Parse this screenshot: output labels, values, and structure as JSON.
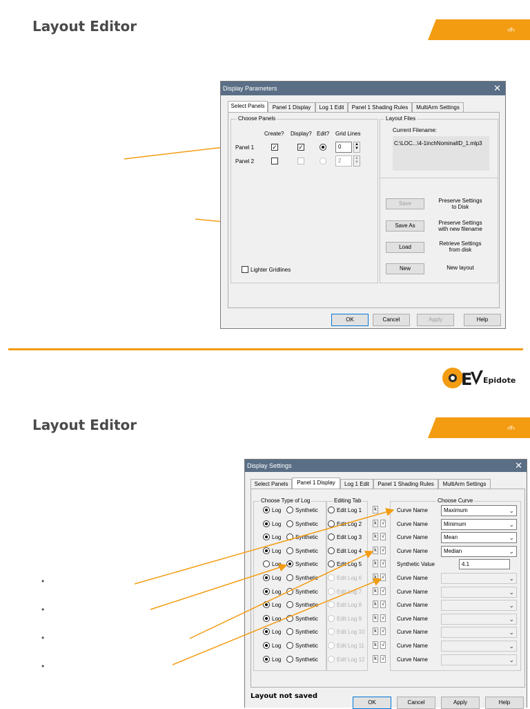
{
  "slide1": {
    "title": "Layout Editor",
    "page_num": "‹#›",
    "dialog": {
      "title": "Display Parameters",
      "close": "✕",
      "tabs": [
        "Select Panels",
        "Panel 1 Display",
        "Log 1 Edit",
        "Panel 1 Shading Rules",
        "MultiArm Settings"
      ],
      "choose_panels": {
        "label": "Choose Panels",
        "headers": {
          "create": "Create?",
          "display": "Display?",
          "edit": "Edit?",
          "grid": "Grid Lines"
        },
        "rows": [
          {
            "name": "Panel 1",
            "create": true,
            "display": true,
            "edit": true,
            "grid": "0"
          },
          {
            "name": "Panel 2",
            "create": false,
            "display": false,
            "edit": false,
            "grid": "2"
          }
        ],
        "lighter_gridlines": "Lighter Gridlines"
      },
      "layout_files": {
        "label": "Layout Files",
        "current_label": "Current Filename:",
        "filename": "C:\\LOC...\\4-1inchNominalID_1.mlp3",
        "actions": [
          {
            "button": "Save",
            "desc1": "Preserve Settings",
            "desc2": "to Disk"
          },
          {
            "button": "Save As",
            "desc1": "Preserve Settings",
            "desc2": "with new filename"
          },
          {
            "button": "Load",
            "desc1": "Retrieve Settings",
            "desc2": "from disk"
          },
          {
            "button": "New",
            "desc1": "New layout",
            "desc2": ""
          }
        ]
      },
      "footer": {
        "ok": "OK",
        "cancel": "Cancel",
        "apply": "Apply",
        "help": "Help"
      }
    }
  },
  "logo_text": "Epidote",
  "slide2": {
    "title": "Layout Editor",
    "page_num": "‹#›",
    "bullets": [
      "•",
      "•",
      "•",
      "•"
    ],
    "dialog": {
      "title": "Display Settings",
      "close": "✕",
      "tabs": [
        "Select Panels",
        "Panel 1 Display",
        "Log 1 Edit",
        "Panel 1 Shading Rules",
        "MultiArm Settings"
      ],
      "choose_type_label": "Choose Type of Log",
      "editing_tab_label": "Editing Tab",
      "choose_curve_label": "Choose Curve",
      "log_label": "Log",
      "synthetic_label": "Synthetic",
      "k_label": "k",
      "v_label": "√",
      "rows": [
        {
          "type": "Log",
          "edit": "Edit Log 1",
          "curve_label": "Curve Name",
          "value": "Maximum",
          "enabled": true
        },
        {
          "type": "Log",
          "edit": "Edit Log 2",
          "curve_label": "Curve Name",
          "value": "Minimum",
          "enabled": true
        },
        {
          "type": "Log",
          "edit": "Edit Log 3",
          "curve_label": "Curve Name",
          "value": "Mean",
          "enabled": true
        },
        {
          "type": "Log",
          "edit": "Edit Log 4",
          "curve_label": "Curve Name",
          "value": "Median",
          "enabled": true
        },
        {
          "type": "Synthetic",
          "edit": "Edit Log 5",
          "curve_label": "Synthetic Value",
          "value": "4.1",
          "enabled": true
        },
        {
          "type": "Log",
          "edit": "Edit Log 6",
          "curve_label": "Curve Name",
          "value": "",
          "enabled": false
        },
        {
          "type": "Log",
          "edit": "Edit Log 7",
          "curve_label": "Curve Name",
          "value": "",
          "enabled": false
        },
        {
          "type": "Log",
          "edit": "Edit Log 8",
          "curve_label": "Curve Name",
          "value": "",
          "enabled": false
        },
        {
          "type": "Log",
          "edit": "Edit Log 9",
          "curve_label": "Curve Name",
          "value": "",
          "enabled": false
        },
        {
          "type": "Log",
          "edit": "Edit Log 10",
          "curve_label": "Curve Name",
          "value": "",
          "enabled": false
        },
        {
          "type": "Log",
          "edit": "Edit Log 11",
          "curve_label": "Curve Name",
          "value": "",
          "enabled": false
        },
        {
          "type": "Log",
          "edit": "Edit Log 12",
          "curve_label": "Curve Name",
          "value": "",
          "enabled": false
        }
      ],
      "status": "Layout not saved",
      "footer": {
        "ok": "OK",
        "cancel": "Cancel",
        "apply": "Apply",
        "help": "Help"
      }
    }
  },
  "colors": {
    "accent": "#f39c12",
    "title_bar": "#5a6f86",
    "dialog_bg": "#f0f0f0"
  }
}
